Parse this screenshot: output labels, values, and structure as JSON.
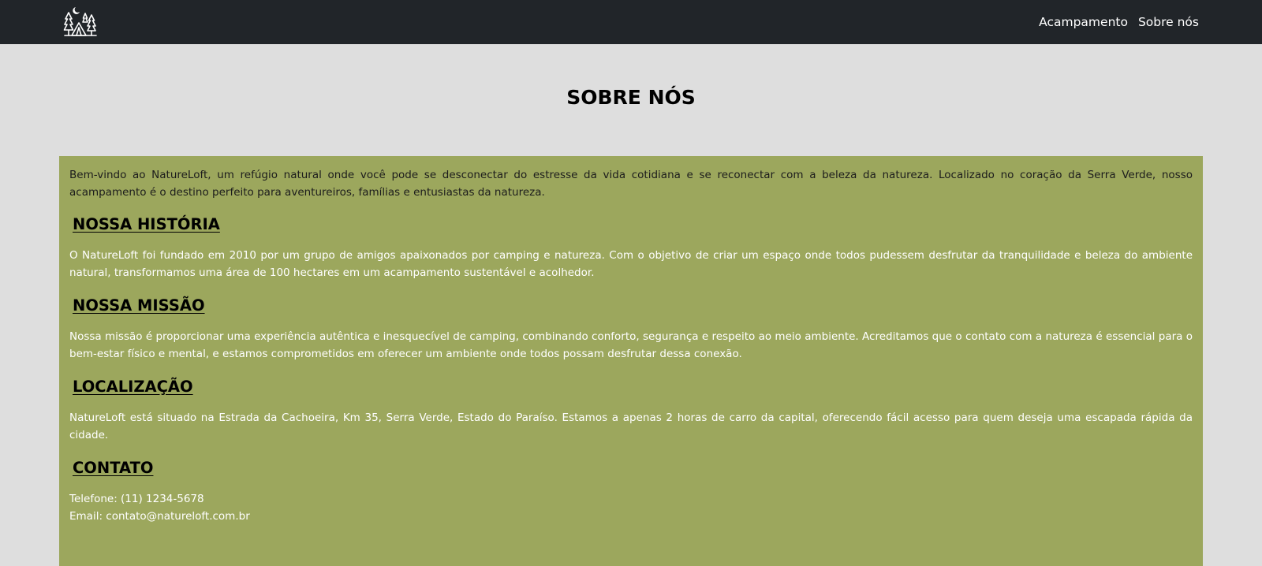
{
  "navbar": {
    "logo_icon": "camping-tent-trees-moon-logo",
    "links": [
      {
        "label": "Acampamento"
      },
      {
        "label": "Sobre nós"
      }
    ]
  },
  "page": {
    "title": "SOBRE NÓS"
  },
  "content": {
    "intro": "Bem-vindo ao NatureLoft, um refúgio natural onde você pode se desconectar do estresse da vida cotidiana e se reconectar com a beleza da natureza. Localizado no coração da Serra Verde, nosso acampamento é o destino perfeito para aventureiros, famílias e entusiastas da natureza.",
    "sections": [
      {
        "heading": "NOSSA HISTÓRIA",
        "text": "O NatureLoft foi fundado em 2010 por um grupo de amigos apaixonados por camping e natureza. Com o objetivo de criar um espaço onde todos pudessem desfrutar da tranquilidade e beleza do ambiente natural, transformamos uma área de 100 hectares em um acampamento sustentável e acolhedor."
      },
      {
        "heading": "NOSSA MISSÃO",
        "text": "Nossa missão é proporcionar uma experiência autêntica e inesquecível de camping, combinando conforto, segurança e respeito ao meio ambiente. Acreditamos que o contato com a natureza é essencial para o bem-estar físico e mental, e estamos comprometidos em oferecer um ambiente onde todos possam desfrutar dessa conexão."
      },
      {
        "heading": "LOCALIZAÇÃO",
        "text": "NatureLoft está situado na Estrada da Cachoeira, Km 35, Serra Verde, Estado do Paraíso. Estamos a apenas 2 horas de carro da capital, oferecendo fácil acesso para quem deseja uma escapada rápida da cidade."
      },
      {
        "heading": "CONTATO",
        "phone": "Telefone: (11) 1234-5678",
        "email": "Email: contato@natureloft.com.br"
      }
    ]
  },
  "colors": {
    "navbar_bg": "#212529",
    "page_bg": "#dedede",
    "content_bg": "#9ca75d"
  }
}
